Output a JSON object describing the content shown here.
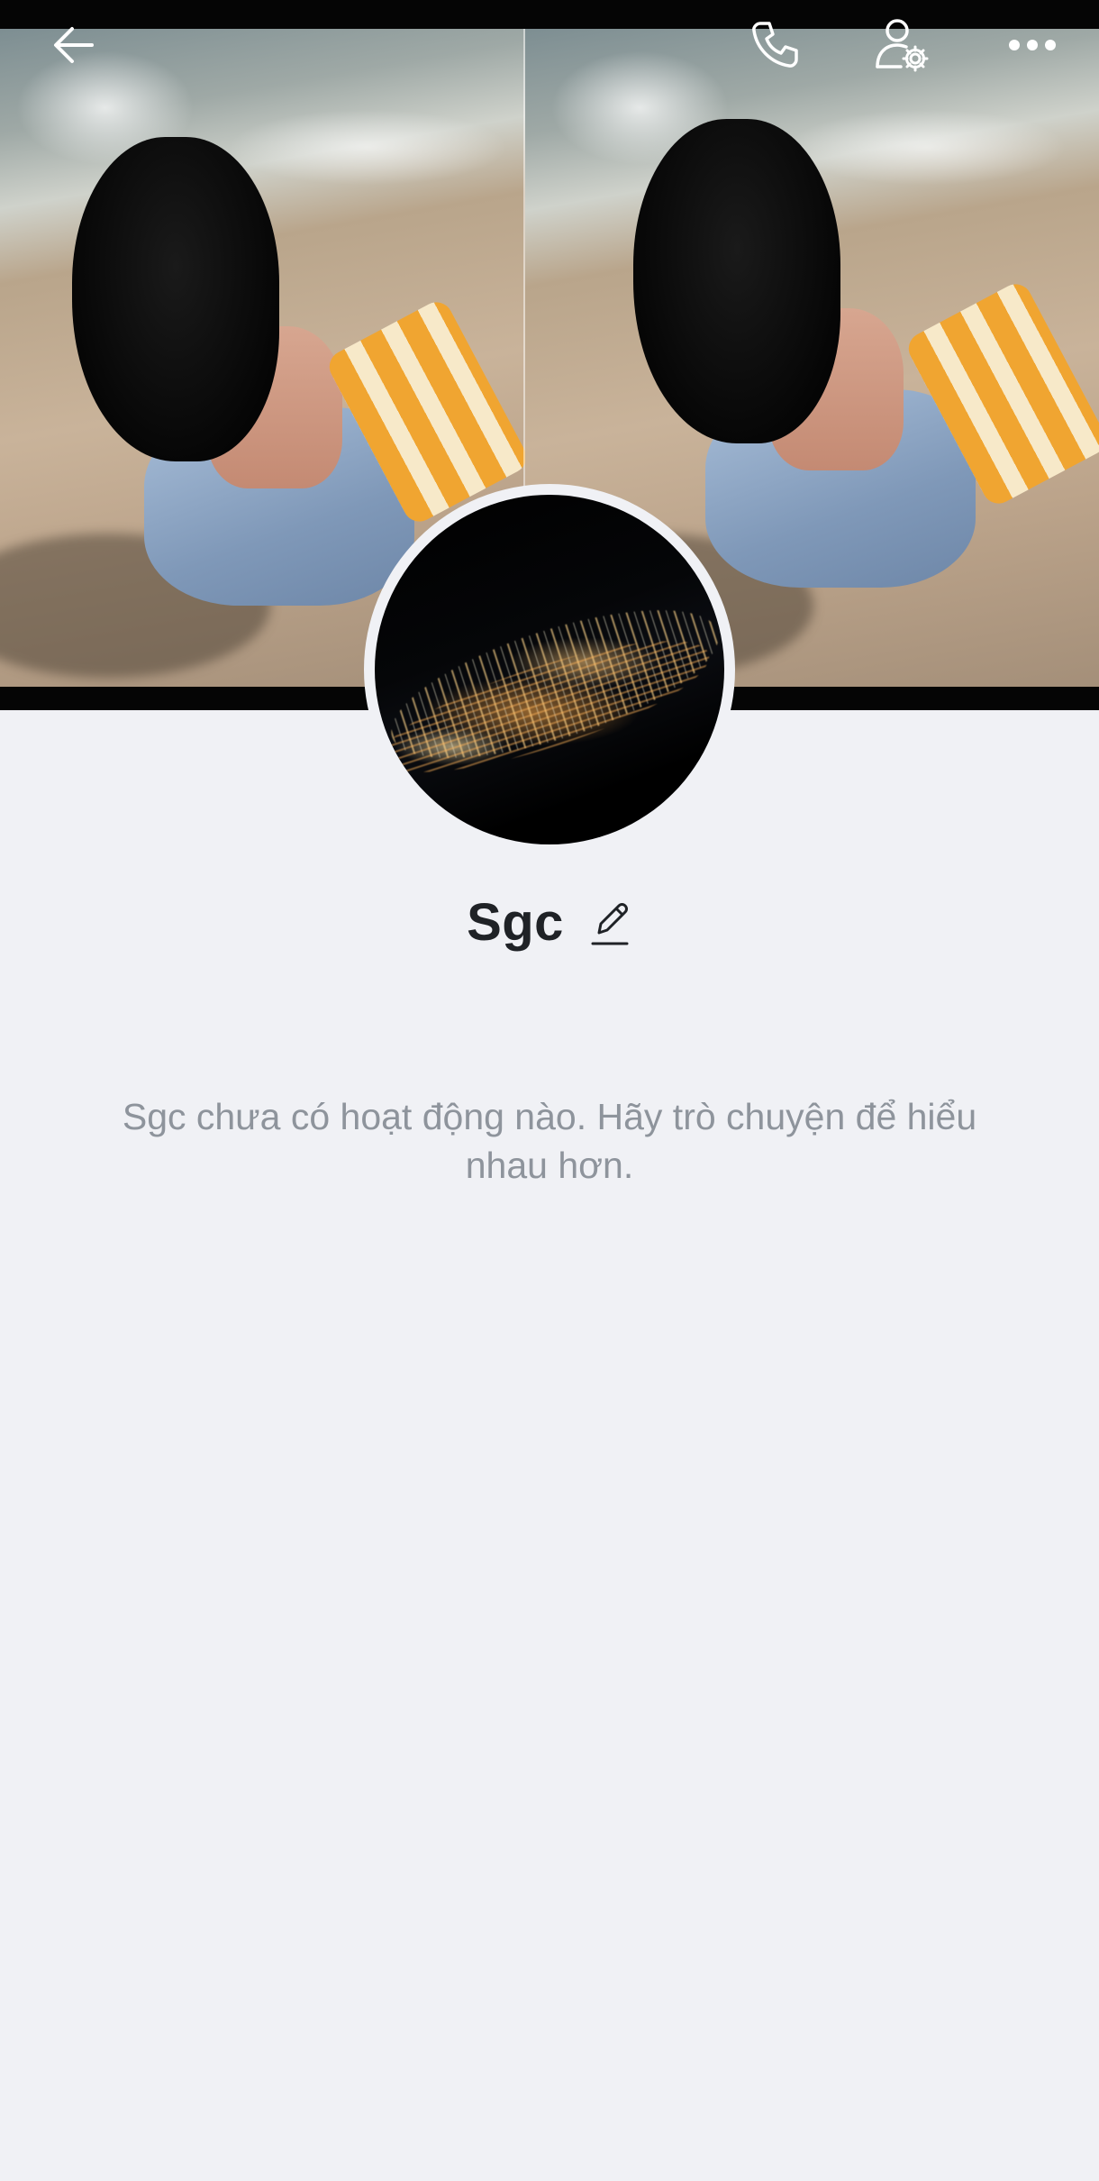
{
  "header": {
    "back_icon": "arrow-left-icon",
    "call_icon": "phone-icon",
    "settings_icon": "user-settings-icon",
    "more_icon": "more-horizontal-icon"
  },
  "cover": {
    "description_icon": "cover-photo"
  },
  "profile": {
    "name": "Sgc",
    "edit_icon": "pencil-icon",
    "activity_empty_message": "Sgc chưa có hoạt động nào. Hãy trò chuyện để hiểu nhau hơn."
  },
  "colors": {
    "background": "#f0f1f5",
    "name_text": "#1f2226",
    "muted_text": "#8e949c",
    "icon_light": "#ffffff"
  }
}
